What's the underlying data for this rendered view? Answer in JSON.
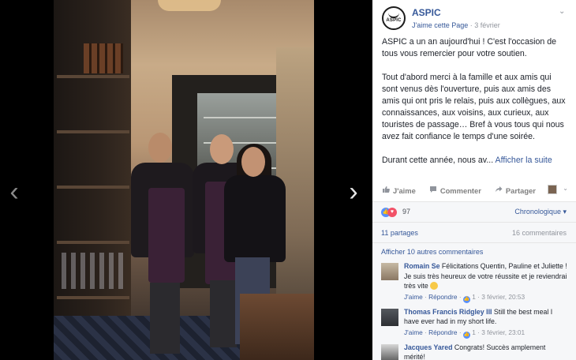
{
  "photo": {
    "prev_arrow": "‹",
    "next_arrow": "›"
  },
  "post": {
    "page_name": "ASPIC",
    "avatar_logo_text": "ASPIC",
    "like_page": "J'aime cette Page",
    "separator": "·",
    "date": "3 février",
    "chevron": "⌄",
    "paragraphs": [
      "ASPIC a un an aujourd'hui ! C'est l'occasion de tous vous remercier pour votre soutien.",
      "Tout d'abord merci à la famille et aux amis qui sont venus dès l'ouverture, puis aux amis des amis qui ont pris le relais, puis aux collègues, aux connaissances, aux voisins, aux curieux, aux touristes de passage… Bref à vous tous qui nous avez fait confiance le temps d'une soirée."
    ],
    "truncated_text": "Durant cette année, nous av...",
    "see_more": "Afficher la suite"
  },
  "actions": {
    "like": "J'aime",
    "comment": "Commenter",
    "share": "Partager",
    "viewer_chevron": "⌄"
  },
  "stats": {
    "reactions_count": "97",
    "sort_label": "Chronologique",
    "shares": "11 partages",
    "comments": "16 commentaires",
    "view_more": "Afficher 10 autres commentaires"
  },
  "comments": [
    {
      "author": "Romain Se",
      "text": "Félicitations Quentin, Pauline et Juliette ! Je suis très heureux de votre réussite et je reviendrai très vite",
      "emoji": true,
      "like_label": "J'aime",
      "reply_label": "Répondre",
      "likes": "1",
      "time": "3 février, 20:53"
    },
    {
      "author": "Thomas Francis Ridgley III",
      "text": "Still the best meal I have ever had in my short life.",
      "emoji": false,
      "like_label": "J'aime",
      "reply_label": "Répondre",
      "likes": "1",
      "time": "3 février, 23:01"
    },
    {
      "author": "Jacques Yared",
      "text": "Congrats! Succès amplement mérité!",
      "emoji": false,
      "like_label": "",
      "reply_label": "",
      "likes": "",
      "time": ""
    }
  ],
  "colors": {
    "link": "#365899",
    "muted": "#90949c",
    "text": "#1d2129",
    "like_blue": "#5890ff",
    "love_red": "#f25268"
  },
  "icons": {
    "like": "thumbs-up-icon",
    "comment": "speech-bubble-icon",
    "share": "share-arrow-icon"
  }
}
